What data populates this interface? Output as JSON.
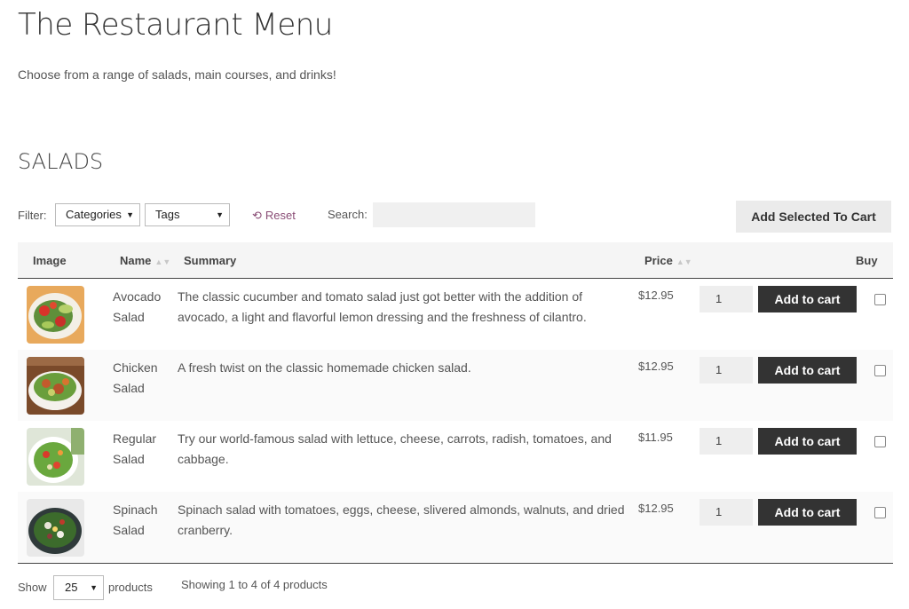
{
  "page": {
    "title": "The Restaurant Menu",
    "intro": "Choose from a range of salads, main courses, and drinks!",
    "section_title": "SALADS"
  },
  "filters": {
    "label": "Filter:",
    "categories": "Categories",
    "tags": "Tags",
    "reset": "Reset",
    "search_label": "Search:",
    "search_value": "",
    "add_selected": "Add Selected To Cart"
  },
  "table": {
    "headers": {
      "image": "Image",
      "name": "Name",
      "summary": "Summary",
      "price": "Price",
      "buy": "Buy"
    },
    "add_to_cart_label": "Add to cart",
    "rows": [
      {
        "name": "Avocado Salad",
        "summary": "The classic cucumber and tomato salad just got better with the addition of avocado, a light and flavorful lemon dressing and the freshness of cilantro.",
        "price": "$12.95",
        "qty": "1"
      },
      {
        "name": "Chicken Salad",
        "summary": "A fresh twist on the classic homemade chicken salad.",
        "price": "$12.95",
        "qty": "1"
      },
      {
        "name": "Regular Salad",
        "summary": "Try our world-famous salad with lettuce, cheese, carrots, radish, tomatoes, and cabbage.",
        "price": "$11.95",
        "qty": "1"
      },
      {
        "name": "Spinach Salad",
        "summary": "Spinach salad with tomatoes, eggs, cheese, slivered almonds, walnuts, and dried cranberry.",
        "price": "$12.95",
        "qty": "1"
      }
    ]
  },
  "footer": {
    "show": "Show",
    "per_page": "25",
    "products": "products",
    "showing": "Showing 1 to 4 of 4 products"
  },
  "colors": {
    "accent": "#8a4d76",
    "button_dark": "#333333"
  }
}
